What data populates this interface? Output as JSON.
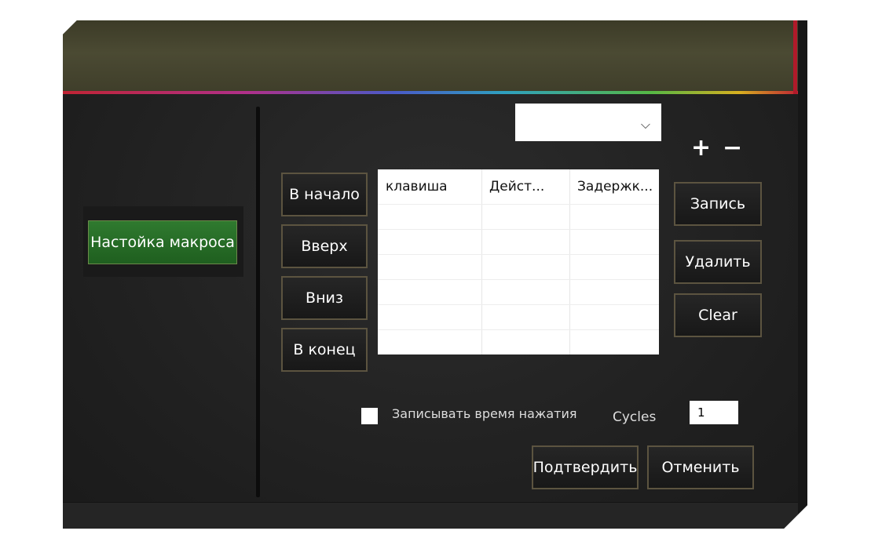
{
  "sidebar": {
    "items": [
      {
        "label": "Настойка макроса"
      }
    ]
  },
  "macro": {
    "select": {
      "value": ""
    },
    "add_symbol": "+",
    "remove_symbol": "−",
    "move_buttons": {
      "to_start": "В начало",
      "up": "Вверх",
      "down": "Вниз",
      "to_end": "В конец"
    },
    "table": {
      "columns": [
        "клавиша",
        "Дейст...",
        "Задержк..."
      ],
      "rows": []
    },
    "action_buttons": {
      "record": "Запись",
      "delete": "Удалить",
      "clear": "Clear"
    },
    "record_time": {
      "label": "Записывать время нажатия",
      "checked": false
    },
    "cycles": {
      "label": "Cycles",
      "value": "1"
    },
    "confirm": "Подтвердить",
    "cancel": "Отменить"
  },
  "colors": {
    "background": "#232323",
    "header": "#4b4a33",
    "active_nav": "#2f7a2f",
    "button_border": "#5c5440",
    "accent_red": "#b01a2a"
  }
}
